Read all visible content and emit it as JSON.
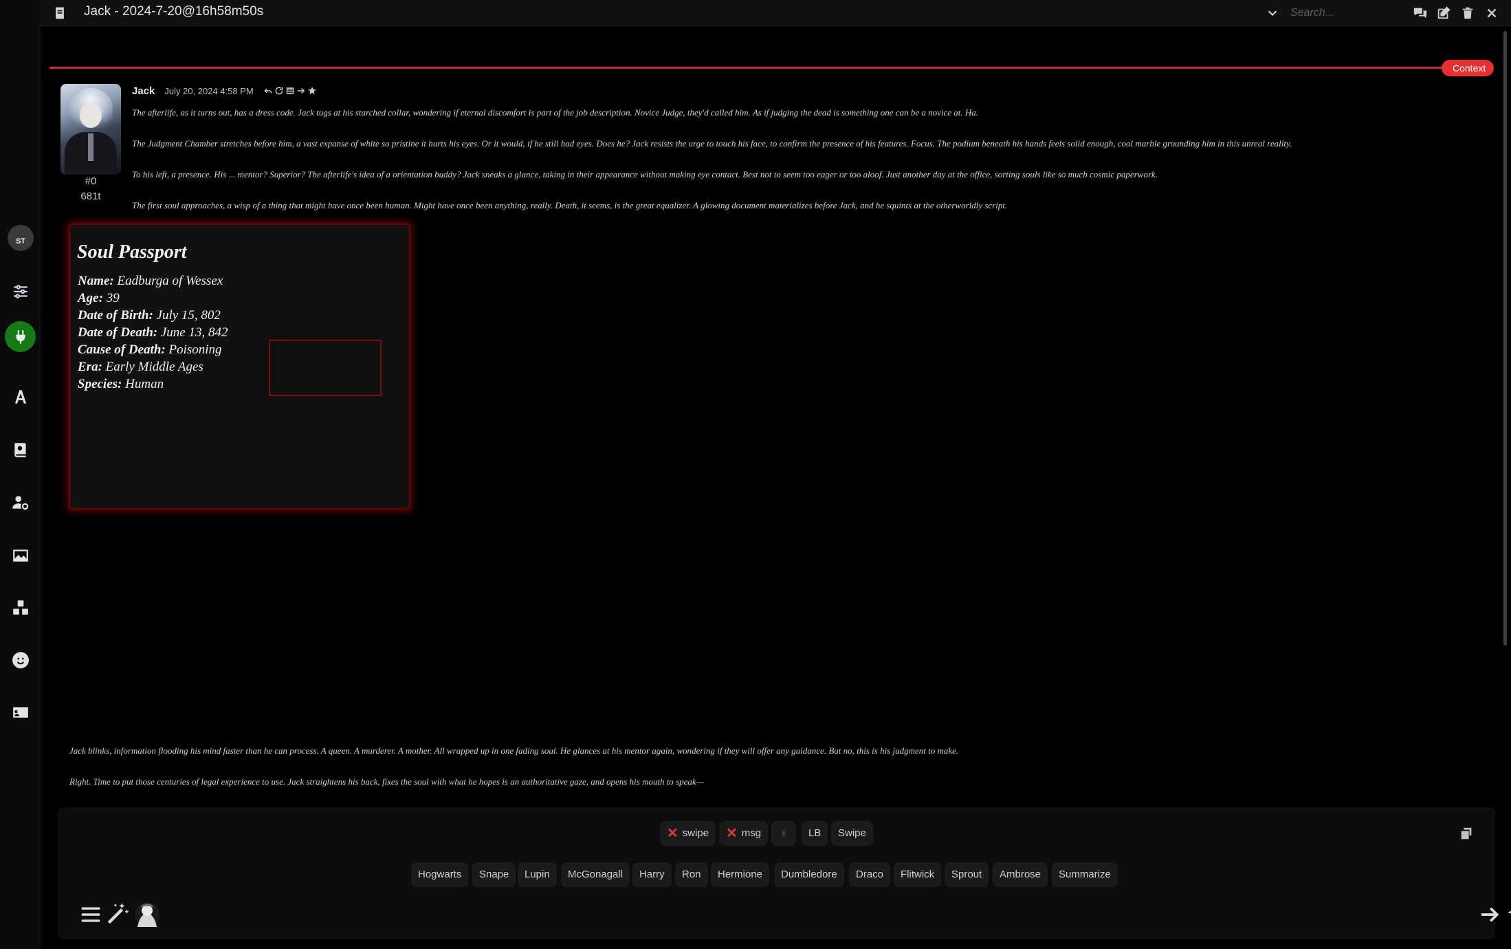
{
  "topbar": {
    "title": "Jack - 2024-7-20@16h58m50s",
    "search_placeholder": "Search..."
  },
  "sidebar": {
    "avatar_label": "ST",
    "icons": [
      "settings-sliders-icon",
      "plug-icon",
      "font-a-icon",
      "book-icon",
      "user-gear-icon",
      "image-icon",
      "extensions-icon",
      "smiley-icon",
      "id-card-icon"
    ]
  },
  "context_label": "Context",
  "message": {
    "name": "Jack",
    "date": "July 20, 2024 4:58 PM",
    "index": "#0",
    "tokens": "681t",
    "paragraphs": [
      "The afterlife, as it turns out, has a dress code. Jack tugs at his starched collar, wondering if eternal discomfort is part of the job description. Novice Judge, they'd called him. As if judging the dead is something one can be a novice at. Ha.",
      "The Judgment Chamber stretches before him, a vast expanse of white so pristine it hurts his eyes. Or it would, if he still had eyes. Does he? Jack resists the urge to touch his face, to confirm the presence of his features. Focus. The podium beneath his hands feels solid enough, cool marble grounding him in this unreal reality.",
      "To his left, a presence. His ... mentor? Superior? The afterlife's idea of a orientation buddy? Jack sneaks a glance, taking in their appearance without making eye contact. Best not to seem too eager or too aloof. Just another day at the office, sorting souls like so much cosmic paperwork.",
      "The first soul approaches, a wisp of a thing that might have once been human. Might have once been anything, really. Death, it seems, is the great equalizer. A glowing document materializes before Jack, and he squints at the otherworldly script."
    ],
    "after_paragraphs": [
      "Jack blinks, information flooding his mind faster than he can process. A queen. A murderer. A mother. All wrapped up in one fading soul. He glances at his mentor again, wondering if they will offer any guidance. But no, this is his judgment to make.",
      "Right. Time to put those centuries of legal experience to use. Jack straightens his back, fixes the soul with what he hopes is an authoritative gaze, and opens his mouth to speak—"
    ]
  },
  "passport": {
    "title": "Soul Passport",
    "fields": [
      {
        "label": "Name:",
        "value": "Eadburga of Wessex"
      },
      {
        "label": "Age:",
        "value": "39"
      },
      {
        "label": "Date of Birth:",
        "value": "July 15, 802"
      },
      {
        "label": "Date of Death:",
        "value": "June 13, 842"
      },
      {
        "label": "Cause of Death:",
        "value": "Poisoning"
      },
      {
        "label": "Era:",
        "value": "Early Middle Ages"
      },
      {
        "label": "Species:",
        "value": "Human"
      }
    ]
  },
  "quick_actions": {
    "row1": [
      "swipe",
      "msg",
      "LB",
      "Swipe"
    ],
    "row2": [
      "Hogwarts",
      "Snape",
      "Lupin",
      "McGonagall",
      "Harry",
      "Ron",
      "Hermione",
      "Dumbledore",
      "Draco",
      "Flitwick",
      "Sprout",
      "Ambrose",
      "Summarize"
    ]
  },
  "colors": {
    "accent_red": "#e53030",
    "active_green": "#167a16",
    "passport_glow": "#aa0000"
  }
}
